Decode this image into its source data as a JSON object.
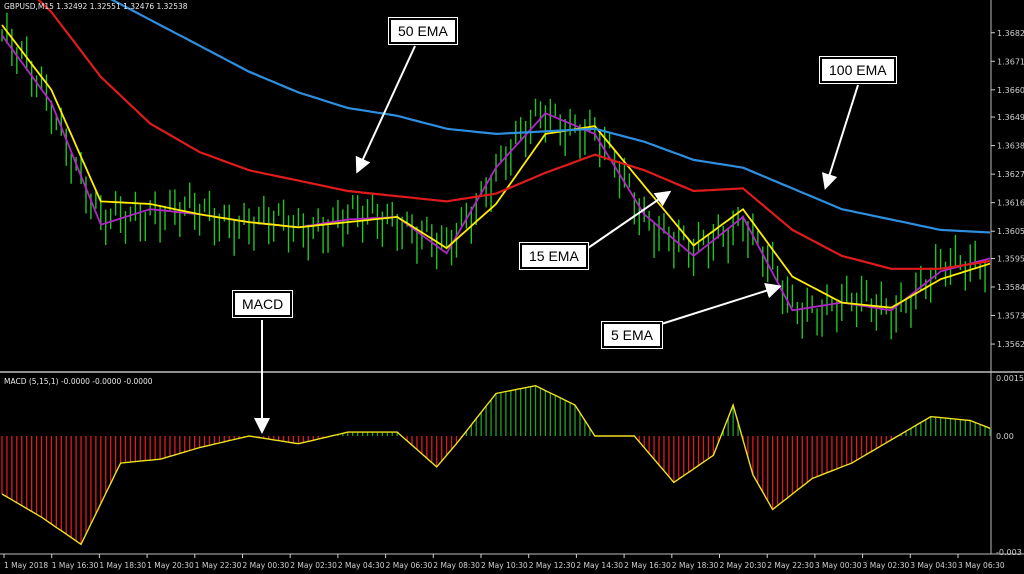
{
  "header": {
    "price_symbol": "GBPUSD,M15",
    "price_ohlc": "1.32492 1.32551 1.32476 1.32538",
    "macd_label": "MACD (5,15,1)",
    "macd_values": "-0.0000 -0.0000 -0.0000"
  },
  "callouts": {
    "ema50": "50 EMA",
    "ema100": "100 EMA",
    "ema15": "15 EMA",
    "ema5": "5 EMA",
    "macd": "MACD"
  },
  "colors": {
    "background": "#000000",
    "candle": "#22c322",
    "ema5": "#b026c8",
    "ema15": "#ffee00",
    "ema50": "#e01b1b",
    "ema100": "#2e8fe0",
    "histogram_up": "#22a022",
    "histogram_down": "#e01a1a",
    "macd_signal": "#f0e020",
    "axis": "#cfcfcf"
  },
  "chart_data": [
    {
      "type": "line",
      "title": "GBPUSD,M15",
      "x_tick_labels": [
        "1 May 2018",
        "1 May 16:30",
        "1 May 18:30",
        "1 May 20:30",
        "1 May 22:30",
        "2 May 00:30",
        "2 May 02:30",
        "2 May 04:30",
        "2 May 06:30",
        "2 May 08:30",
        "2 May 10:30",
        "2 May 12:30",
        "2 May 14:30",
        "2 May 16:30",
        "2 May 18:30",
        "2 May 20:30",
        "2 May 22:30",
        "3 May 00:30",
        "3 May 02:30",
        "3 May 04:30",
        "3 May 06:30"
      ],
      "y_tick_labels": [
        "1.36820",
        "1.36710",
        "1.36600",
        "1.36495",
        "1.36385",
        "1.36275",
        "1.36165",
        "1.36055",
        "1.35950",
        "1.35840",
        "1.35730",
        "1.35620"
      ],
      "ylim": [
        1.3552,
        1.369
      ],
      "x": [
        0,
        5,
        10,
        15,
        20,
        25,
        30,
        35,
        40,
        45,
        50,
        55,
        60,
        65,
        70,
        75,
        80,
        85,
        90,
        95,
        100
      ],
      "series": [
        {
          "name": "5 EMA",
          "values": [
            1.3681,
            1.3655,
            1.3608,
            1.3614,
            1.3612,
            1.3609,
            1.3607,
            1.361,
            1.3611,
            1.3597,
            1.363,
            1.3651,
            1.3643,
            1.3612,
            1.3596,
            1.3611,
            1.3575,
            1.3578,
            1.3575,
            1.359,
            1.3595
          ]
        },
        {
          "name": "15 EMA",
          "values": [
            1.3685,
            1.366,
            1.3617,
            1.3616,
            1.3612,
            1.3609,
            1.3607,
            1.3609,
            1.3611,
            1.3599,
            1.3616,
            1.3643,
            1.3646,
            1.3623,
            1.36,
            1.3614,
            1.3588,
            1.3578,
            1.3576,
            1.3587,
            1.3593
          ]
        },
        {
          "name": "50 EMA",
          "values": [
            1.3708,
            1.369,
            1.3665,
            1.3647,
            1.3636,
            1.3629,
            1.3625,
            1.3621,
            1.3619,
            1.3617,
            1.362,
            1.3628,
            1.3635,
            1.3629,
            1.3621,
            1.3622,
            1.3606,
            1.3596,
            1.3591,
            1.3591,
            1.3594
          ]
        },
        {
          "name": "100 EMA",
          "values": [
            1.3716,
            1.3708,
            1.3697,
            1.3687,
            1.3677,
            1.3667,
            1.3659,
            1.3653,
            1.365,
            1.3645,
            1.3643,
            1.3644,
            1.3645,
            1.364,
            1.3633,
            1.363,
            1.3622,
            1.3614,
            1.361,
            1.3606,
            1.3605
          ]
        }
      ]
    },
    {
      "type": "bar",
      "title": "MACD (5,15,1)",
      "y_tick_labels": [
        "0.0015",
        "0.00",
        "-0.003"
      ],
      "ylim": [
        -0.003,
        0.0015
      ],
      "x": [
        0,
        4,
        8,
        12,
        16,
        20,
        25,
        30,
        35,
        40,
        44,
        46,
        50,
        54,
        58,
        60,
        64,
        68,
        72,
        74,
        76,
        78,
        82,
        86,
        90,
        94,
        98,
        100
      ],
      "values": [
        -0.0015,
        -0.0021,
        -0.0028,
        -0.0007,
        -0.0006,
        -0.0003,
        0.0,
        -0.0002,
        0.0001,
        0.0001,
        -0.0008,
        -0.0002,
        0.0011,
        0.0013,
        0.0008,
        0.0,
        0.0,
        -0.0012,
        -0.0005,
        0.0008,
        -0.001,
        -0.0019,
        -0.0011,
        -0.0007,
        -0.0001,
        0.0005,
        0.0004,
        0.0002
      ]
    }
  ]
}
